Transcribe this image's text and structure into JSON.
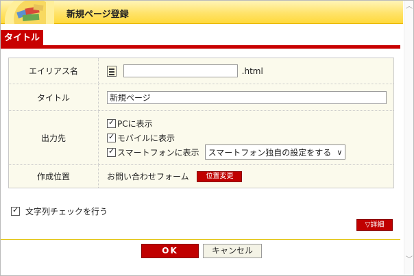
{
  "header": {
    "title": "新規ページ登録"
  },
  "tab": {
    "label": "タイトル"
  },
  "form": {
    "alias": {
      "label": "エイリアス名",
      "value": "",
      "suffix": ".html"
    },
    "title": {
      "label": "タイトル",
      "value": "新規ページ"
    },
    "output": {
      "label": "出力先",
      "pc": "PCに表示",
      "mobile": "モバイルに表示",
      "smartphone": "スマートフォンに表示",
      "smartphone_select": "スマートフォン独自の設定をする"
    },
    "position": {
      "label": "作成位置",
      "value": "お問い合わせフォーム",
      "change_button": "位置変更"
    }
  },
  "string_check": {
    "label": "文字列チェックを行う"
  },
  "detail_button": "▽詳細",
  "buttons": {
    "ok": "OK",
    "cancel": "キャンセル"
  }
}
